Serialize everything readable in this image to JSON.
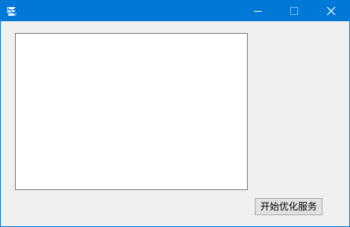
{
  "window": {
    "title": "",
    "accent_color": "#0078d7",
    "background_color": "#f0f0f0",
    "app_icon": "app-logo-icon",
    "controls": {
      "minimize_icon": "minimize-icon",
      "maximize_icon": "maximize-icon",
      "close_icon": "close-icon"
    }
  },
  "main": {
    "output_text": "",
    "start_button_label": "开始优化服务"
  }
}
